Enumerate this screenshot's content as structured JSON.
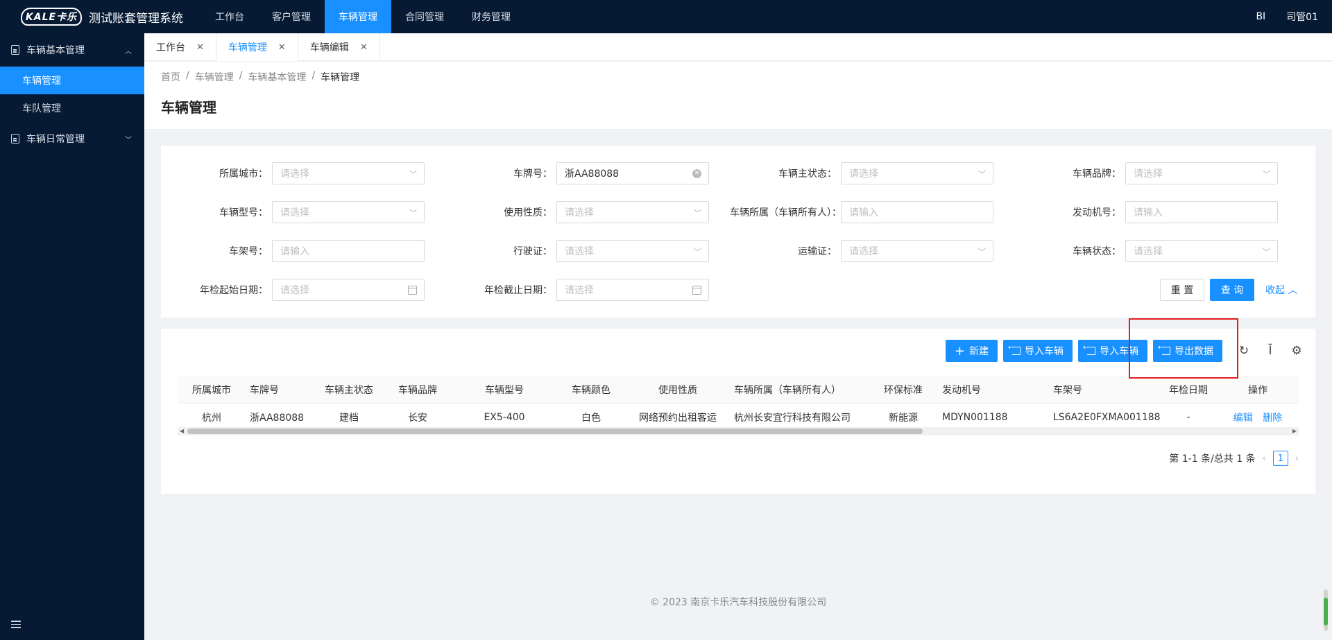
{
  "app": {
    "logo_text": "KALE卡乐",
    "title": "测试账套管理系统",
    "top_nav": [
      "工作台",
      "客户管理",
      "车辆管理",
      "合同管理",
      "财务管理"
    ],
    "active_top_nav": "车辆管理",
    "bi_label": "BI",
    "user_name": "司管01"
  },
  "sidebar": {
    "group1": "车辆基本管理",
    "items": [
      "车辆管理",
      "车队管理"
    ],
    "group2": "车辆日常管理"
  },
  "tabs": [
    "工作台",
    "车辆管理",
    "车辆编辑"
  ],
  "active_tab": "车辆管理",
  "breadcrumb": [
    "首页",
    "车辆管理",
    "车辆基本管理",
    "车辆管理"
  ],
  "breadcrumb_sep": "/",
  "page_title": "车辆管理",
  "filters": {
    "city_label": "所属城市：",
    "city_placeholder": "请选择",
    "plate_label": "车牌号：",
    "plate_value": "浙AA88088",
    "main_status_label": "车辆主状态：",
    "main_status_placeholder": "请选择",
    "brand_label": "车辆品牌：",
    "brand_placeholder": "请选择",
    "model_label": "车辆型号：",
    "model_placeholder": "请选择",
    "usage_label": "使用性质：",
    "usage_placeholder": "请选择",
    "owner_label": "车辆所属（车辆所有人）：",
    "owner_placeholder": "请输入",
    "engine_label": "发动机号：",
    "engine_placeholder": "请输入",
    "vin_label": "车架号：",
    "vin_placeholder": "请输入",
    "license_label": "行驶证：",
    "license_placeholder": "请选择",
    "transport_label": "运输证：",
    "transport_placeholder": "请选择",
    "status_label": "车辆状态：",
    "status_placeholder": "请选择",
    "inspect_start_label": "年检起始日期：",
    "inspect_start_placeholder": "请选择",
    "inspect_end_label": "年检截止日期：",
    "inspect_end_placeholder": "请选择",
    "reset_label": "重 置",
    "query_label": "查 询",
    "collapse_label": "收起"
  },
  "toolbar": {
    "new_label": "新建",
    "import1_label": "导入车辆",
    "import2_label": "导入车辆",
    "export_label": "导出数据"
  },
  "table": {
    "columns": [
      "所属城市",
      "车牌号",
      "车辆主状态",
      "车辆品牌",
      "车辆型号",
      "车辆颜色",
      "使用性质",
      "车辆所属（车辆所有人）",
      "环保标准",
      "发动机号",
      "车架号",
      "年检日期",
      "操作"
    ],
    "rows": [
      [
        "杭州",
        "浙AA88088",
        "建档",
        "长安",
        "EX5-400",
        "白色",
        "网络预约出租客运",
        "杭州长安宜行科技有限公司",
        "新能源",
        "MDYN001188",
        "LS6A2E0FXMA001188",
        "-"
      ]
    ],
    "edit_label": "编辑",
    "delete_label": "删除"
  },
  "pagination": {
    "summary": "第 1-1 条/总共 1 条",
    "current_page": "1"
  },
  "footer": "© 2023 南京卡乐汽车科技股份有限公司",
  "colors": {
    "nav_bg": "#061a34",
    "primary": "#1890ff",
    "highlight": "#e01e1e"
  }
}
